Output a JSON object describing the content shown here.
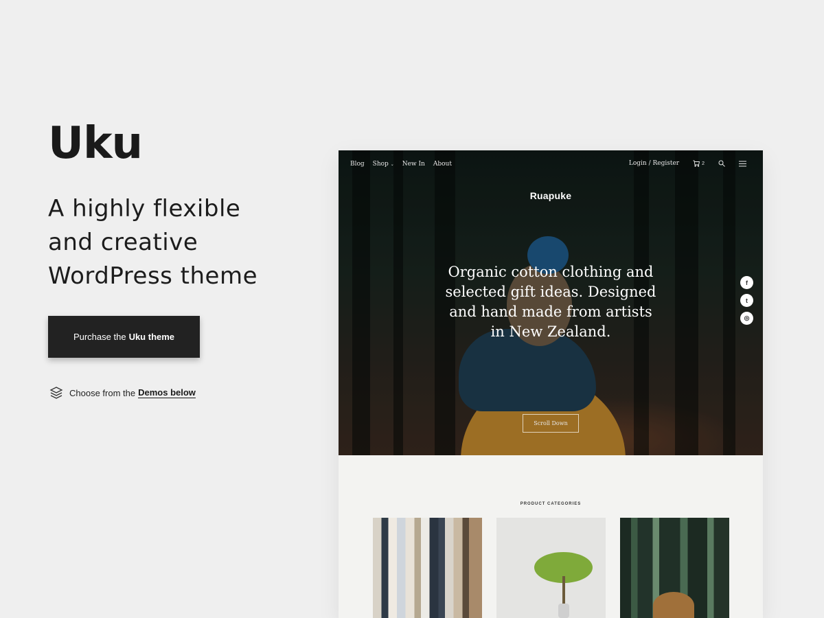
{
  "left": {
    "title": "Uku",
    "tagline_lines": [
      "A highly flexible",
      "and creative",
      "WordPress theme"
    ],
    "purchase_prefix": "Purchase the",
    "purchase_bold": "Uku theme",
    "demos_prefix": "Choose from the",
    "demos_link": "Demos below"
  },
  "preview": {
    "nav": [
      "Blog",
      "Shop",
      "New In",
      "About"
    ],
    "login": "Login / Register",
    "cart_count": "2",
    "site_title": "Ruapuke",
    "hero_lines": [
      "Organic cotton clothing and",
      "selected gift ideas. Designed",
      "and hand made from artists",
      "in New Zealand."
    ],
    "social": [
      "f",
      "t",
      "◎"
    ],
    "scroll_label": "Scroll Down",
    "categories_label": "PRODUCT CATEGORIES"
  }
}
